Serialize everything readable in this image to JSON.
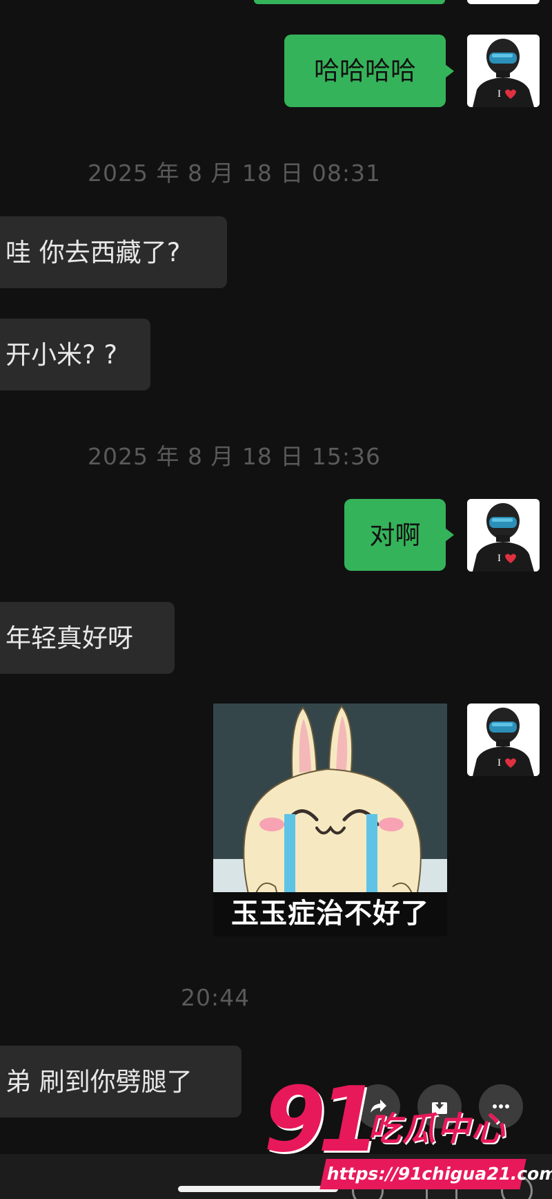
{
  "conversation": {
    "messages": [
      {
        "side": "outgoing",
        "text": "哈哈哈哈"
      },
      {
        "side": "incoming",
        "text": "哇 你去西藏了?"
      },
      {
        "side": "incoming",
        "text": "开小米? ?"
      },
      {
        "side": "outgoing",
        "text": "对啊"
      },
      {
        "side": "incoming",
        "text": "年轻真好呀"
      },
      {
        "side": "incoming",
        "text": "弟 刷到你劈腿了"
      }
    ],
    "timestamps": [
      "2025 年 8 月 18 日 08:31",
      "2025 年 8 月 18 日 15:36",
      "20:44"
    ],
    "sticker": {
      "caption": "玉玉症治不好了",
      "icon": "crying-rabbit-sticker"
    }
  },
  "avatar": {
    "icon": "helmet-rider-avatar",
    "shirt_text": "I"
  },
  "message_actions": [
    "share-icon",
    "download-icon",
    "more-icon"
  ],
  "watermark": {
    "number": "91",
    "brand": "吃瓜中心",
    "url": "https://91chigua21.com"
  },
  "colors": {
    "background": "#111111",
    "outgoing_bubble": "#35b35a",
    "incoming_bubble": "#2b2b2b",
    "timestamp": "#5a5a5a",
    "watermark": "#e8195a"
  }
}
